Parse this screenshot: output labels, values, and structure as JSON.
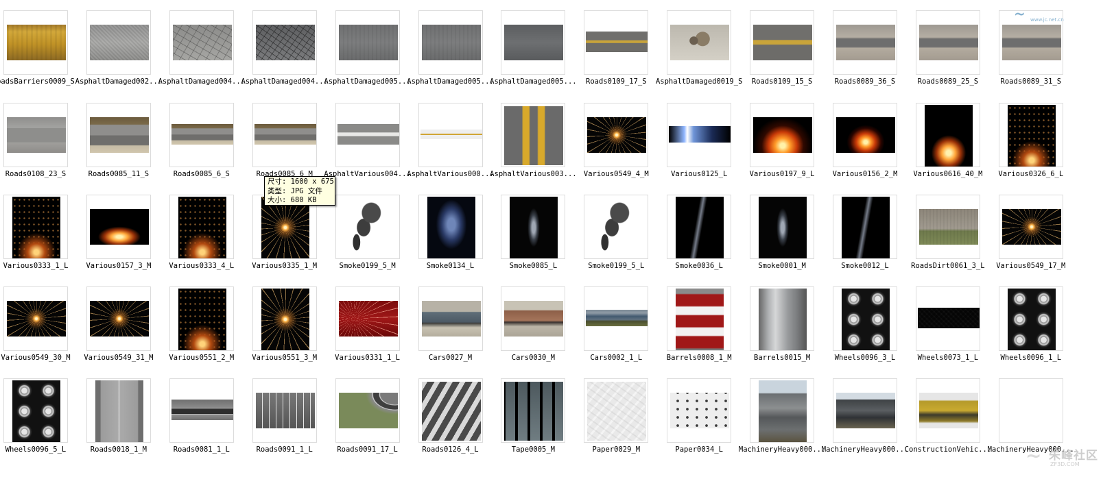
{
  "tooltip": {
    "line1": "尺寸: 1600 x 675",
    "line2": "类型: JPG 文件",
    "line3": "大小: 680 KB"
  },
  "watermarks": {
    "top_logo": "~",
    "top_url": "www.jc.net.cn",
    "bottom_logo": "~",
    "bottom_text": "朱峰社区",
    "bottom_url": "ZF3D.COM"
  },
  "files": [
    {
      "label": "oadsBarriers0009_S",
      "tex": "barrier",
      "shape": "wide"
    },
    {
      "label": "AsphaltDamaged002...",
      "tex": "asphalt",
      "shape": "wide"
    },
    {
      "label": "AsphaltDamaged004...",
      "tex": "cracked",
      "shape": "wide"
    },
    {
      "label": "AsphaltDamaged004...",
      "tex": "cracked-dark",
      "shape": "wide"
    },
    {
      "label": "AsphaltDamaged005...",
      "tex": "road-grey",
      "shape": "wide"
    },
    {
      "label": "AsphaltDamaged005...",
      "tex": "road-grey",
      "shape": "wide"
    },
    {
      "label": "AsphaltDamaged005...",
      "tex": "road-dark",
      "shape": "wide"
    },
    {
      "label": "Roads0109_17_S",
      "tex": "road-yellow",
      "shape": "strip"
    },
    {
      "label": "AsphaltDamaged0019_S",
      "tex": "rocky",
      "shape": "wide"
    },
    {
      "label": "Roads0109_15_S",
      "tex": "road-yellow",
      "shape": "wide"
    },
    {
      "label": "Roads0089_36_S",
      "tex": "road-pale",
      "shape": "wide"
    },
    {
      "label": "Roads0089_25_S",
      "tex": "road-pale",
      "shape": "wide"
    },
    {
      "label": "Roads0089_31_S",
      "tex": "road-pale",
      "shape": "wide"
    },
    {
      "label": "Roads0108_23_S",
      "tex": "road-plain",
      "shape": "wide"
    },
    {
      "label": "Roads0085_11_S",
      "tex": "road-edge",
      "shape": "wide"
    },
    {
      "label": "Roads0085_6_S",
      "tex": "road-edge",
      "shape": "strip"
    },
    {
      "label": "Roads0085_6_M",
      "tex": "road-edge",
      "shape": "strip"
    },
    {
      "label": "AsphaltVarious004...",
      "tex": "road-white",
      "shape": "strip"
    },
    {
      "label": "AsphaltVarious000...",
      "tex": "yellow-line",
      "shape": "line"
    },
    {
      "label": "AsphaltVarious003...",
      "tex": "yellow-double",
      "shape": "square"
    },
    {
      "label": "Various0549_4_M",
      "tex": "spark",
      "shape": "wide"
    },
    {
      "label": "Various0125_L",
      "tex": "blue-flare",
      "shape": "flat"
    },
    {
      "label": "Various0197_9_L",
      "tex": "fire",
      "shape": "wide"
    },
    {
      "label": "Various0156_2_M",
      "tex": "fire-tall",
      "shape": "wide"
    },
    {
      "label": "Various0616_40_M",
      "tex": "campfire",
      "shape": "tall"
    },
    {
      "label": "Various0326_6_L",
      "tex": "ember",
      "shape": "tall"
    },
    {
      "label": "Various0333_1_L",
      "tex": "ember",
      "shape": "tall"
    },
    {
      "label": "Various0157_3_M",
      "tex": "campfire",
      "shape": "wide"
    },
    {
      "label": "Various0333_4_L",
      "tex": "ember",
      "shape": "tall"
    },
    {
      "label": "Various0335_1_M",
      "tex": "spark",
      "shape": "tall"
    },
    {
      "label": "Smoke0199_5_M",
      "tex": "smoke-white",
      "shape": "square"
    },
    {
      "label": "Smoke0134_L",
      "tex": "smoke-blue",
      "shape": "tall"
    },
    {
      "label": "Smoke0085_L",
      "tex": "smoke-dark",
      "shape": "tall"
    },
    {
      "label": "Smoke0199_5_L",
      "tex": "smoke-white",
      "shape": "square"
    },
    {
      "label": "Smoke0036_L",
      "tex": "smoke-wisp",
      "shape": "tall"
    },
    {
      "label": "Smoke0001_M",
      "tex": "smoke-dark",
      "shape": "tall"
    },
    {
      "label": "Smoke0012_L",
      "tex": "smoke-wisp",
      "shape": "tall"
    },
    {
      "label": "RoadsDirt0061_3_L",
      "tex": "dirt",
      "shape": "wide"
    },
    {
      "label": "Various0549_17_M",
      "tex": "spark",
      "shape": "wide"
    },
    {
      "label": "Various0549_30_M",
      "tex": "spark",
      "shape": "wide"
    },
    {
      "label": "Various0549_31_M",
      "tex": "spark",
      "shape": "wide"
    },
    {
      "label": "Various0551_2_M",
      "tex": "ember",
      "shape": "tall"
    },
    {
      "label": "Various0551_3_M",
      "tex": "spark",
      "shape": "tall"
    },
    {
      "label": "Various0331_1_L",
      "tex": "red-spark",
      "shape": "wide"
    },
    {
      "label": "Cars0027_M",
      "tex": "car",
      "shape": "wide"
    },
    {
      "label": "Cars0030_M",
      "tex": "car-rust",
      "shape": "wide"
    },
    {
      "label": "Cars0002_1_L",
      "tex": "car-wreck",
      "shape": "flat"
    },
    {
      "label": "Barrels0008_1_M",
      "tex": "barrel-red",
      "shape": "tall"
    },
    {
      "label": "Barrels0015_M",
      "tex": "barrel-grey",
      "shape": "tall"
    },
    {
      "label": "Wheels0096_3_L",
      "tex": "wheels",
      "shape": "tall"
    },
    {
      "label": "Wheels0073_1_L",
      "tex": "tire",
      "shape": "strip"
    },
    {
      "label": "Wheels0096_1_L",
      "tex": "wheels",
      "shape": "tall"
    },
    {
      "label": "Wheels0096_5_L",
      "tex": "wheels",
      "shape": "tall"
    },
    {
      "label": "Roads0018_1_M",
      "tex": "runway",
      "shape": "tall"
    },
    {
      "label": "Roads0081_1_L",
      "tex": "road-top",
      "shape": "strip"
    },
    {
      "label": "Roads0091_1_L",
      "tex": "parking",
      "shape": "wide"
    },
    {
      "label": "Roads0091_17_L",
      "tex": "curve",
      "shape": "wide"
    },
    {
      "label": "Roads0126_4_L",
      "tex": "crosswalk",
      "shape": "square"
    },
    {
      "label": "Tape0005_M",
      "tex": "tape",
      "shape": "square"
    },
    {
      "label": "Paper0029_M",
      "tex": "paper",
      "shape": "square"
    },
    {
      "label": "Paper0034_L",
      "tex": "paper-spots",
      "shape": "wide"
    },
    {
      "label": "MachineryHeavy000...",
      "tex": "machine",
      "shape": "tall"
    },
    {
      "label": "MachineryHeavy000...",
      "tex": "machine-dark",
      "shape": "wide"
    },
    {
      "label": "ConstructionVehic...",
      "tex": "dozer",
      "shape": "wide"
    },
    {
      "label": "MachineryHeavy000...",
      "tex": "turbine",
      "shape": "square"
    }
  ]
}
